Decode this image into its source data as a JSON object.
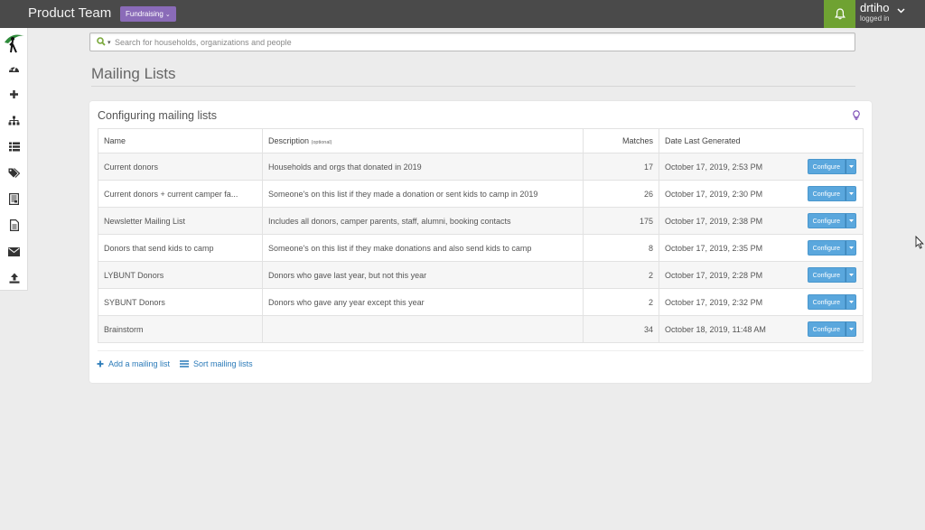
{
  "topbar": {
    "team": "Product Team",
    "module_button": "Fundraising",
    "user_name": "drtiho",
    "user_status": "logged in"
  },
  "sidebar": {
    "items": [
      {
        "icon": "logo-icon"
      },
      {
        "icon": "dashboard-icon"
      },
      {
        "icon": "plus-icon"
      },
      {
        "icon": "sitemap-icon"
      },
      {
        "icon": "list-icon"
      },
      {
        "icon": "tags-icon"
      },
      {
        "icon": "reports-icon"
      },
      {
        "icon": "document-icon"
      },
      {
        "icon": "envelope-icon"
      },
      {
        "icon": "upload-icon"
      }
    ]
  },
  "search": {
    "placeholder": "Search for households, organizations and people"
  },
  "page": {
    "title": "Mailing Lists"
  },
  "panel": {
    "title": "Configuring mailing lists",
    "columns": {
      "name": "Name",
      "description": "Description",
      "description_note": "(optional)",
      "matches": "Matches",
      "date": "Date Last Generated"
    },
    "configure_label": "Configure",
    "rows": [
      {
        "name": "Current donors",
        "description": "Households and orgs that donated in 2019",
        "matches": "17",
        "date": "October 17, 2019, 2:53 PM"
      },
      {
        "name": "Current donors + current camper fa...",
        "description": "Someone's on this list if they made a donation or sent kids to camp in 2019",
        "matches": "26",
        "date": "October 17, 2019, 2:30 PM"
      },
      {
        "name": "Newsletter Mailing List",
        "description": "Includes all donors, camper parents, staff, alumni, booking contacts",
        "matches": "175",
        "date": "October 17, 2019, 2:38 PM"
      },
      {
        "name": "Donors that send kids to camp",
        "description": "Someone's on this list if they make donations and also send kids to camp",
        "matches": "8",
        "date": "October 17, 2019, 2:35 PM"
      },
      {
        "name": "LYBUNT Donors",
        "description": "Donors who gave last year, but not this year",
        "matches": "2",
        "date": "October 17, 2019, 2:28 PM"
      },
      {
        "name": "SYBUNT Donors",
        "description": "Donors who gave any year except this year",
        "matches": "2",
        "date": "October 17, 2019, 2:32 PM"
      },
      {
        "name": "Brainstorm",
        "description": "",
        "matches": "34",
        "date": "October 18, 2019, 11:48 AM"
      }
    ],
    "add_link": "Add a mailing list",
    "sort_link": "Sort mailing lists"
  },
  "colors": {
    "topbar": "#4a4a4a",
    "module_button": "#8a6bb8",
    "bell_bg": "#6fa232",
    "configure": "#5aa7dd",
    "link": "#2a7ab8"
  }
}
